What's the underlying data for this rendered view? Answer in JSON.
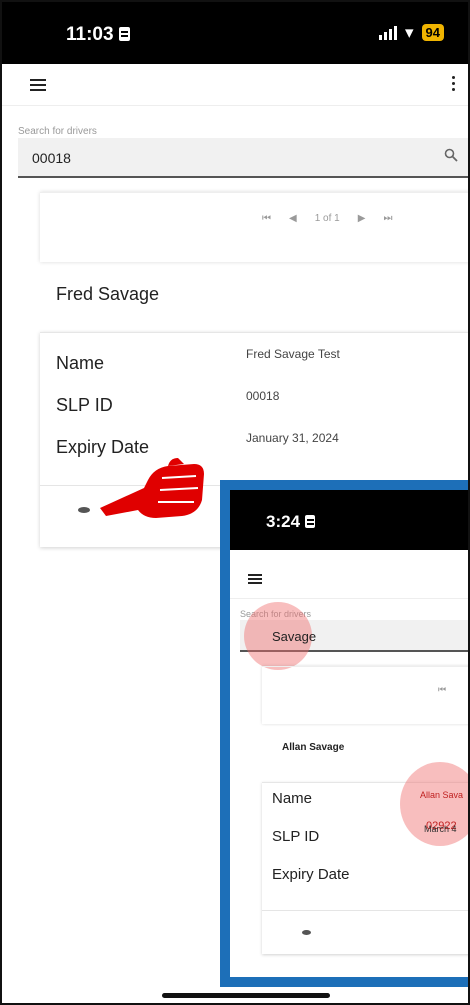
{
  "status_bar": {
    "time": "11:03",
    "battery": "94",
    "wifi_icon": "wifi-icon",
    "signal_icon": "signal-icon"
  },
  "app_bar": {
    "menu_icon": "hamburger-menu-icon",
    "more_icon": "more-vertical-icon"
  },
  "search": {
    "label": "Search for drivers",
    "value": "00018",
    "icon": "search-icon"
  },
  "pager": {
    "first_icon": "first-page-icon",
    "prev_icon": "prev-page-icon",
    "page_text": "1 of 1",
    "next_icon": "next-page-icon",
    "last_icon": "last-page-icon"
  },
  "card": {
    "title": "Fred Savage",
    "rows": [
      {
        "label": "Name",
        "value": "Fred Savage Test"
      },
      {
        "label": "SLP ID",
        "value": "00018"
      },
      {
        "label": "Expiry Date",
        "value": "January 31, 2024"
      }
    ],
    "action_icon": "view-icon"
  },
  "annotation": {
    "arrow_icon": "red-pointing-hand-icon",
    "arrow_color": "#e00000",
    "highlight_color": "#f06e6e",
    "inset_border_color": "#1d6fb8"
  },
  "inset": {
    "time": "3:24",
    "search_label": "Search for drivers",
    "search_value": "Savage",
    "card_title": "Allan Savage",
    "rows": [
      {
        "label": "Name",
        "value": "Allan Sava"
      },
      {
        "label": "SLP ID",
        "value": "02922"
      },
      {
        "label": "Expiry Date",
        "value": "March 4"
      }
    ]
  }
}
